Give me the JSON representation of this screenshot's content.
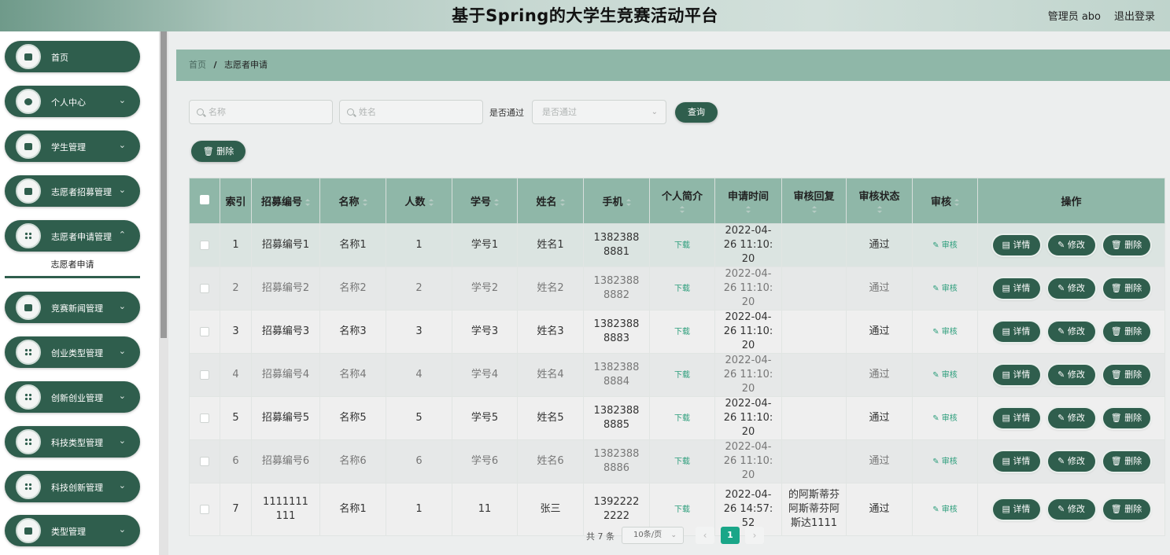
{
  "header": {
    "title": "基于Spring的大学生竞赛活动平台",
    "user": "管理员 abo",
    "logout": "退出登录"
  },
  "sidebar": {
    "items": [
      {
        "label": "首页",
        "icon": "home-icon"
      },
      {
        "label": "个人中心",
        "icon": "person-icon"
      },
      {
        "label": "学生管理",
        "icon": "chart-icon"
      },
      {
        "label": "志愿者招募管理",
        "icon": "message-icon"
      },
      {
        "label": "志愿者申请管理",
        "icon": "grid-icon"
      },
      {
        "label": "竞赛新闻管理",
        "icon": "monitor-icon"
      },
      {
        "label": "创业类型管理",
        "icon": "grid-icon"
      },
      {
        "label": "创新创业管理",
        "icon": "grid-icon"
      },
      {
        "label": "科技类型管理",
        "icon": "grid-icon"
      },
      {
        "label": "科技创新管理",
        "icon": "grid-icon"
      },
      {
        "label": "类型管理",
        "icon": "box-icon"
      }
    ],
    "sub_item": "志愿者申请"
  },
  "breadcrumb": {
    "home": "首页",
    "separator": "/",
    "current": "志愿者申请"
  },
  "filters": {
    "name_placeholder": "名称",
    "xingming_placeholder": "姓名",
    "passed_label": "是否通过",
    "passed_placeholder": "是否通过",
    "query_button": "查询",
    "delete_button": "删除"
  },
  "table": {
    "headers": [
      "索引",
      "招募编号",
      "名称",
      "人数",
      "学号",
      "姓名",
      "手机",
      "个人简介",
      "申请时间",
      "审核回复",
      "审核状态",
      "审核",
      "操作"
    ],
    "rows": [
      {
        "idx": "1",
        "code": "招募编号1",
        "name": "名称1",
        "count": "1",
        "sid": "学号1",
        "person": "姓名1",
        "phone": "13823888881",
        "intro": "下载",
        "time": "2022-04-26 11:10:20",
        "reply": "",
        "status": "通过",
        "audit": "审核"
      },
      {
        "idx": "2",
        "code": "招募编号2",
        "name": "名称2",
        "count": "2",
        "sid": "学号2",
        "person": "姓名2",
        "phone": "13823888882",
        "intro": "下载",
        "time": "2022-04-26 11:10:20",
        "reply": "",
        "status": "通过",
        "audit": "审核"
      },
      {
        "idx": "3",
        "code": "招募编号3",
        "name": "名称3",
        "count": "3",
        "sid": "学号3",
        "person": "姓名3",
        "phone": "13823888883",
        "intro": "下载",
        "time": "2022-04-26 11:10:20",
        "reply": "",
        "status": "通过",
        "audit": "审核"
      },
      {
        "idx": "4",
        "code": "招募编号4",
        "name": "名称4",
        "count": "4",
        "sid": "学号4",
        "person": "姓名4",
        "phone": "13823888884",
        "intro": "下载",
        "time": "2022-04-26 11:10:20",
        "reply": "",
        "status": "通过",
        "audit": "审核"
      },
      {
        "idx": "5",
        "code": "招募编号5",
        "name": "名称5",
        "count": "5",
        "sid": "学号5",
        "person": "姓名5",
        "phone": "13823888885",
        "intro": "下载",
        "time": "2022-04-26 11:10:20",
        "reply": "",
        "status": "通过",
        "audit": "审核"
      },
      {
        "idx": "6",
        "code": "招募编号6",
        "name": "名称6",
        "count": "6",
        "sid": "学号6",
        "person": "姓名6",
        "phone": "13823888886",
        "intro": "下载",
        "time": "2022-04-26 11:10:20",
        "reply": "",
        "status": "通过",
        "audit": "审核"
      },
      {
        "idx": "7",
        "code": "1111111111",
        "name": "名称1",
        "count": "1",
        "sid": "11",
        "person": "张三",
        "phone": "13922222222",
        "intro": "下载",
        "time": "2022-04-26 14:57:52",
        "reply": "的阿斯蒂芬阿斯蒂芬阿斯达1111",
        "status": "通过",
        "audit": "审核"
      }
    ],
    "actions": {
      "detail": "详情",
      "edit": "修改",
      "delete": "删除"
    }
  },
  "pagination": {
    "total": "共 7 条",
    "page_size": "10条/页",
    "prev": "‹",
    "current": "1",
    "next": "›"
  },
  "colors": {
    "primary": "#2f5e4d",
    "table_header": "#8fb7a8",
    "link": "#2a9d7a",
    "page_active": "#1aa688"
  }
}
